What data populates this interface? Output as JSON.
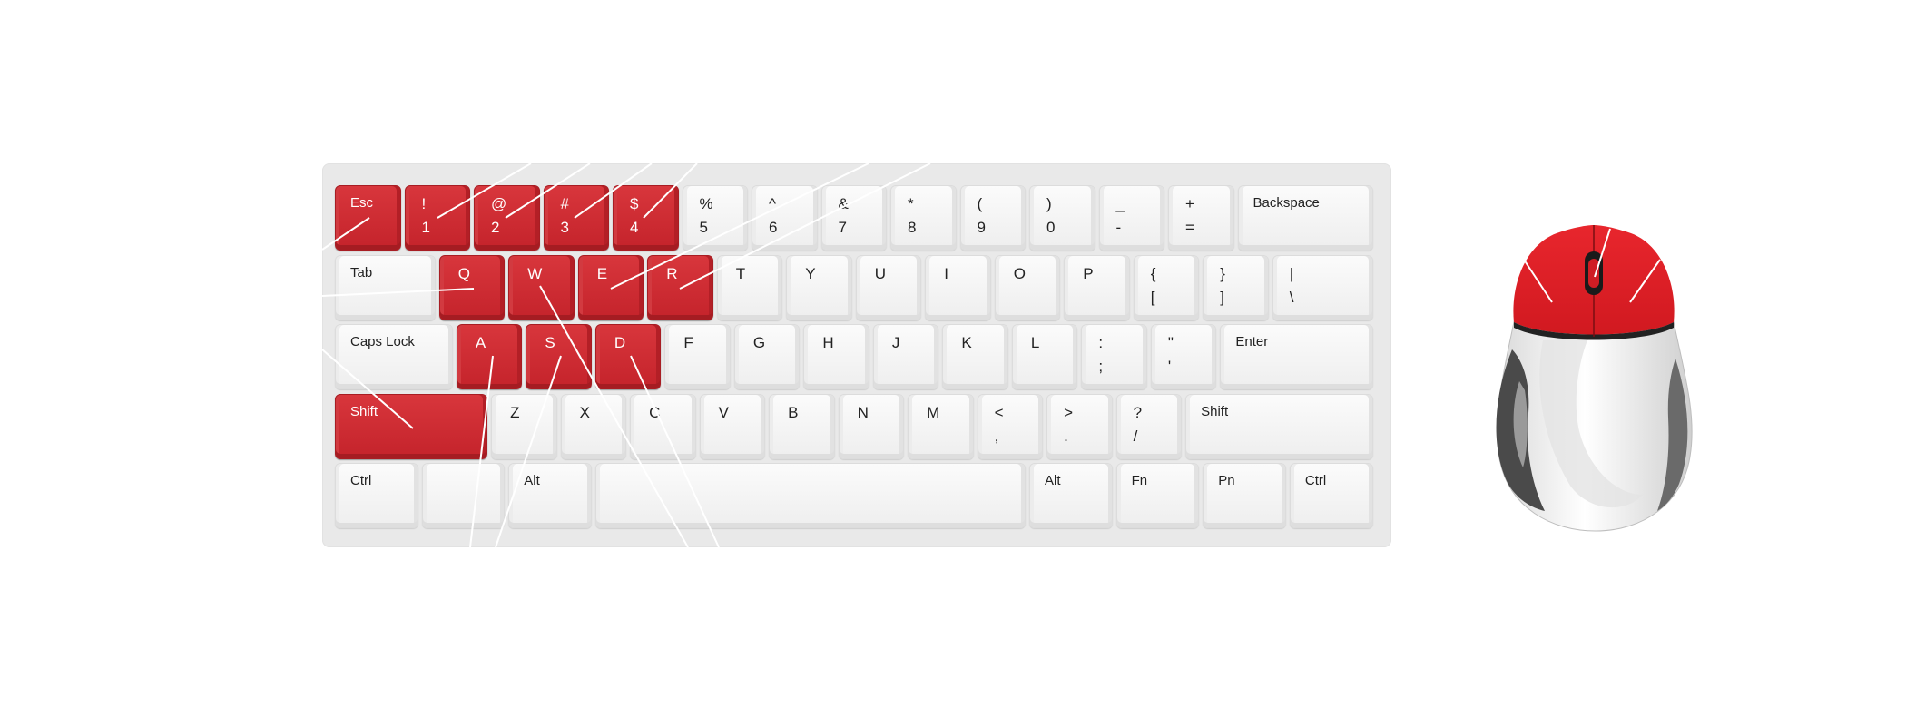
{
  "colors": {
    "highlight": "#c8262d",
    "keycap": "#f4f4f4",
    "board": "#e9e9e9",
    "mouse_body": "#f2f2f2",
    "mouse_grip": "#555555"
  },
  "keyboard": {
    "rows": [
      [
        {
          "top": "Esc",
          "red": true,
          "type": "label"
        },
        {
          "top": "!",
          "bottom": "1",
          "red": true
        },
        {
          "top": "@",
          "bottom": "2",
          "red": true
        },
        {
          "top": "#",
          "bottom": "3",
          "red": true
        },
        {
          "top": "$",
          "bottom": "4",
          "red": true
        },
        {
          "top": "%",
          "bottom": "5"
        },
        {
          "top": "^",
          "bottom": "6"
        },
        {
          "top": "&",
          "bottom": "7"
        },
        {
          "top": "*",
          "bottom": "8"
        },
        {
          "top": "(",
          "bottom": "9"
        },
        {
          "top": ")",
          "bottom": "0"
        },
        {
          "top": "_",
          "bottom": "-"
        },
        {
          "top": "+",
          "bottom": "="
        },
        {
          "top": "Backspace",
          "type": "label"
        }
      ],
      [
        {
          "top": "Tab",
          "type": "label"
        },
        {
          "top": "Q",
          "red": true,
          "type": "single"
        },
        {
          "top": "W",
          "red": true,
          "type": "single"
        },
        {
          "top": "E",
          "red": true,
          "type": "single"
        },
        {
          "top": "R",
          "red": true,
          "type": "single"
        },
        {
          "top": "T",
          "type": "single"
        },
        {
          "top": "Y",
          "type": "single"
        },
        {
          "top": "U",
          "type": "single"
        },
        {
          "top": "I",
          "type": "single"
        },
        {
          "top": "O",
          "type": "single"
        },
        {
          "top": "P",
          "type": "single"
        },
        {
          "top": "{",
          "bottom": "["
        },
        {
          "top": "}",
          "bottom": "]"
        },
        {
          "top": "|",
          "bottom": "\\"
        }
      ],
      [
        {
          "top": "Caps Lock",
          "type": "label"
        },
        {
          "top": "A",
          "red": true,
          "type": "single"
        },
        {
          "top": "S",
          "red": true,
          "type": "single"
        },
        {
          "top": "D",
          "red": true,
          "type": "single"
        },
        {
          "top": "F",
          "type": "single"
        },
        {
          "top": "G",
          "type": "single"
        },
        {
          "top": "H",
          "type": "single"
        },
        {
          "top": "J",
          "type": "single"
        },
        {
          "top": "K",
          "type": "single"
        },
        {
          "top": "L",
          "type": "single"
        },
        {
          "top": ":",
          "bottom": ";"
        },
        {
          "top": "\"",
          "bottom": "'"
        },
        {
          "top": "Enter",
          "type": "label"
        }
      ],
      [
        {
          "top": "Shift",
          "red": true,
          "type": "label"
        },
        {
          "top": "Z",
          "type": "single"
        },
        {
          "top": "X",
          "type": "single"
        },
        {
          "top": "C",
          "type": "single"
        },
        {
          "top": "V",
          "type": "single"
        },
        {
          "top": "B",
          "type": "single"
        },
        {
          "top": "N",
          "type": "single"
        },
        {
          "top": "M",
          "type": "single"
        },
        {
          "top": "<",
          "bottom": ","
        },
        {
          "top": ">",
          "bottom": "."
        },
        {
          "top": "?",
          "bottom": "/"
        },
        {
          "top": "Shift",
          "type": "label"
        }
      ],
      [
        {
          "top": "Ctrl",
          "type": "label"
        },
        {
          "top": "",
          "type": "label"
        },
        {
          "top": "Alt",
          "type": "label"
        },
        {
          "top": "",
          "type": "label"
        },
        {
          "top": "Alt",
          "type": "label"
        },
        {
          "top": "Fn",
          "type": "label"
        },
        {
          "top": "Pn",
          "type": "label"
        },
        {
          "top": "Ctrl",
          "type": "label"
        }
      ]
    ]
  },
  "mouse": {
    "highlighted_parts": [
      "left-button",
      "scroll-wheel",
      "right-button"
    ]
  }
}
